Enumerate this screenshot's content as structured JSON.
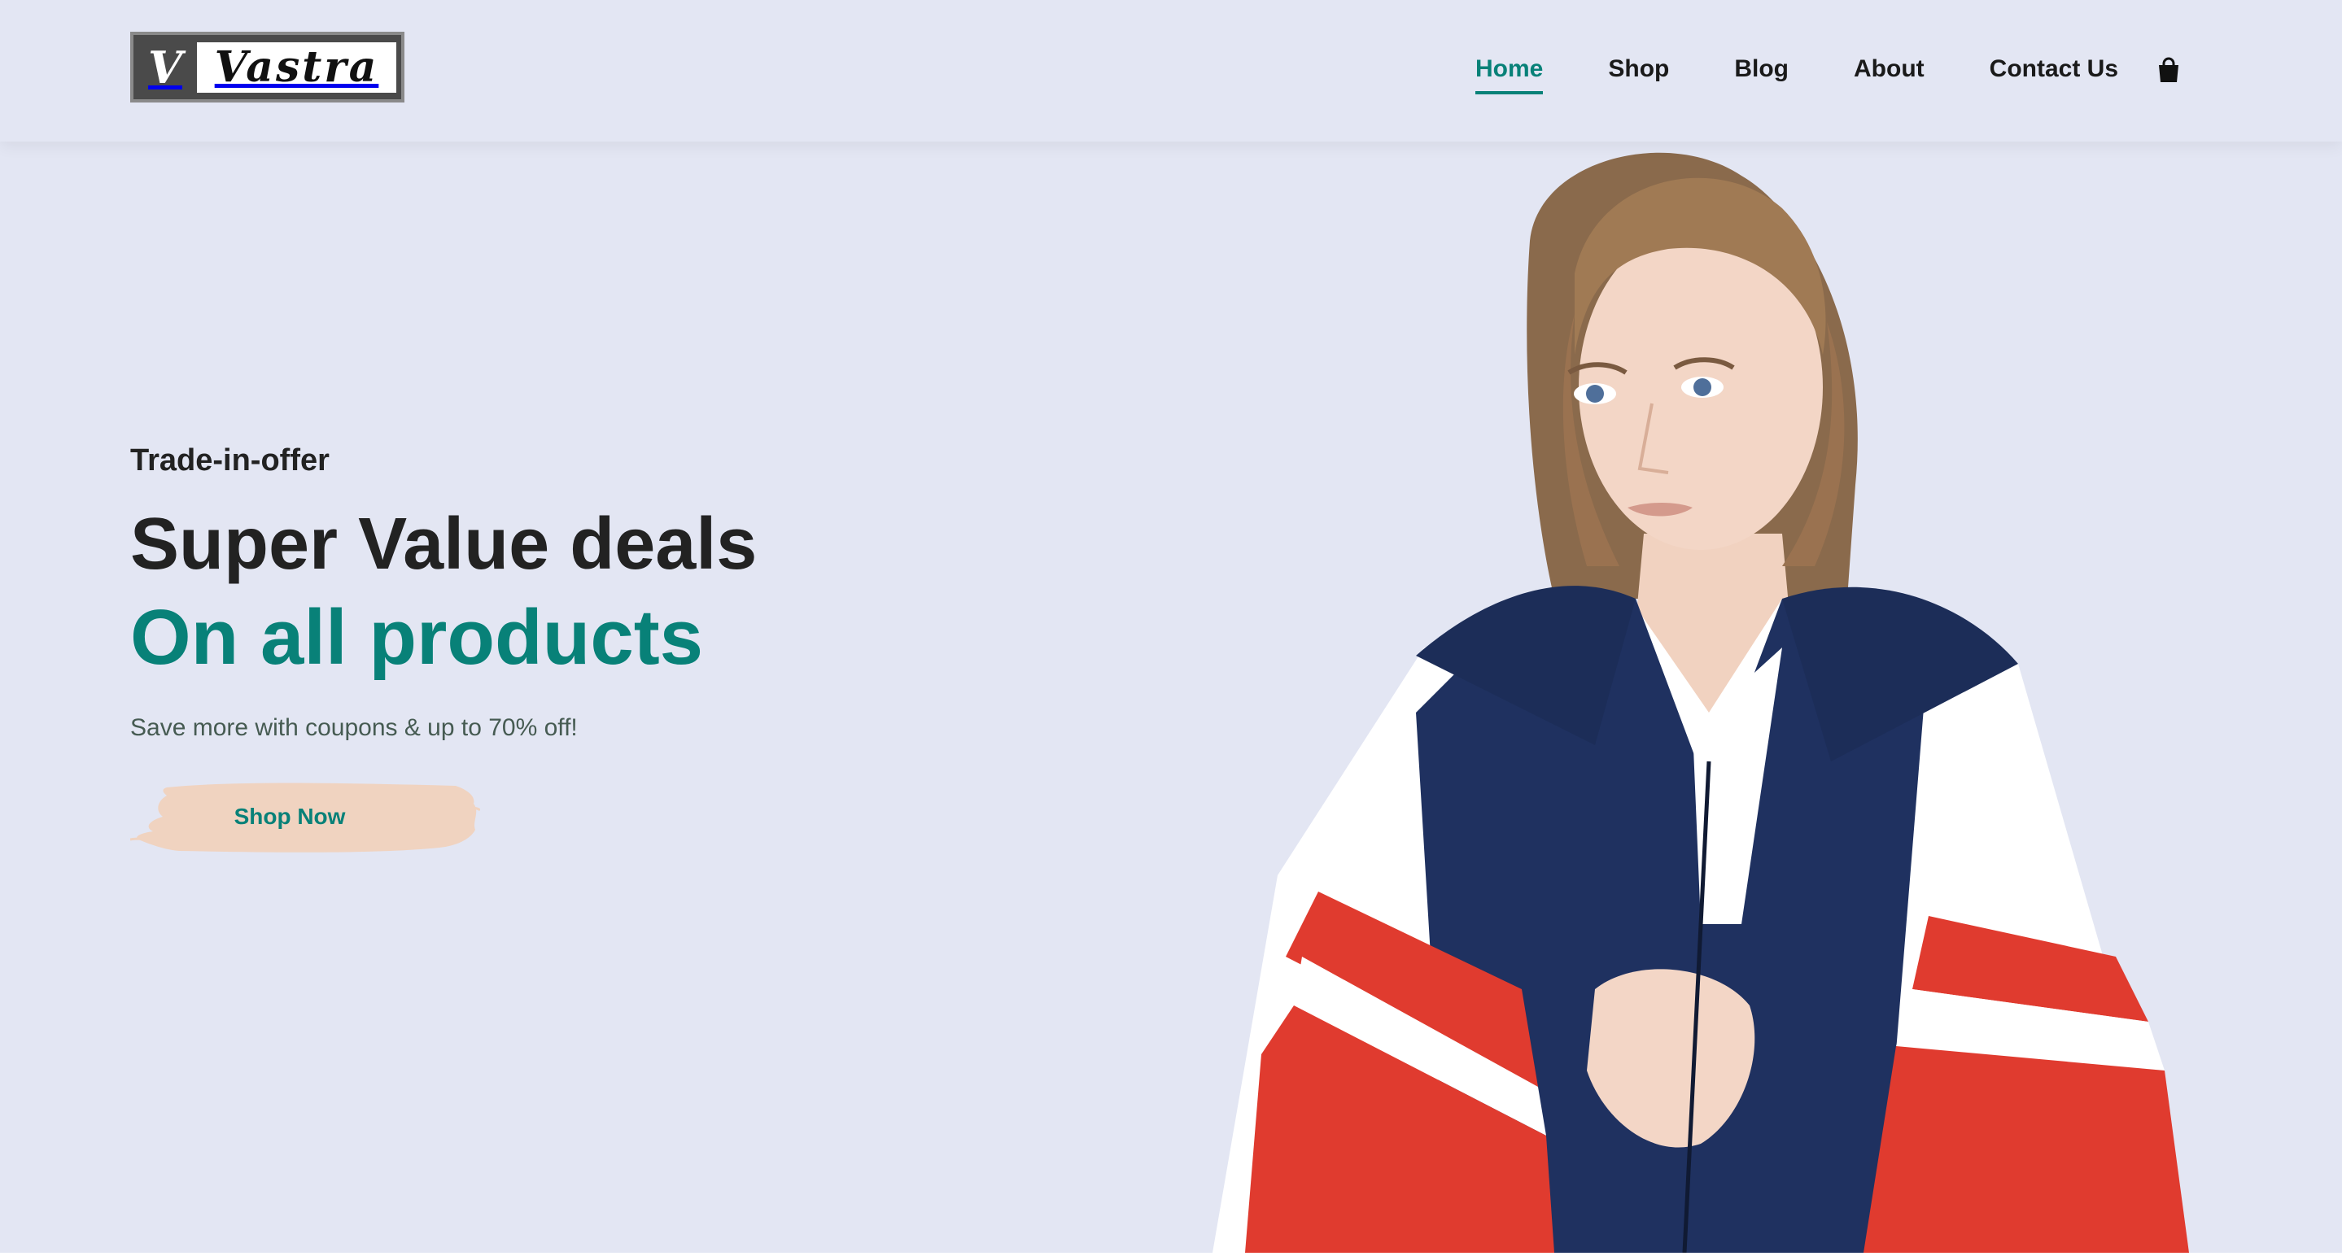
{
  "brand": {
    "logo_letter": "V",
    "logo_text": "Vastra"
  },
  "nav": {
    "items": [
      {
        "label": "Home",
        "active": true
      },
      {
        "label": "Shop",
        "active": false
      },
      {
        "label": "Blog",
        "active": false
      },
      {
        "label": "About",
        "active": false
      },
      {
        "label": "Contact Us",
        "active": false
      }
    ],
    "cart_icon": "shopping-bag-icon"
  },
  "hero": {
    "eyebrow": "Trade-in-offer",
    "headline": "Super Value deals",
    "headline_accent": "On all products",
    "subtext": "Save more with coupons & up to 70% off!",
    "cta_label": "Shop Now"
  },
  "colors": {
    "background": "#e3e6f3",
    "accent": "#088178",
    "button_brush": "#f0d3c0",
    "text_dark": "#222222"
  }
}
